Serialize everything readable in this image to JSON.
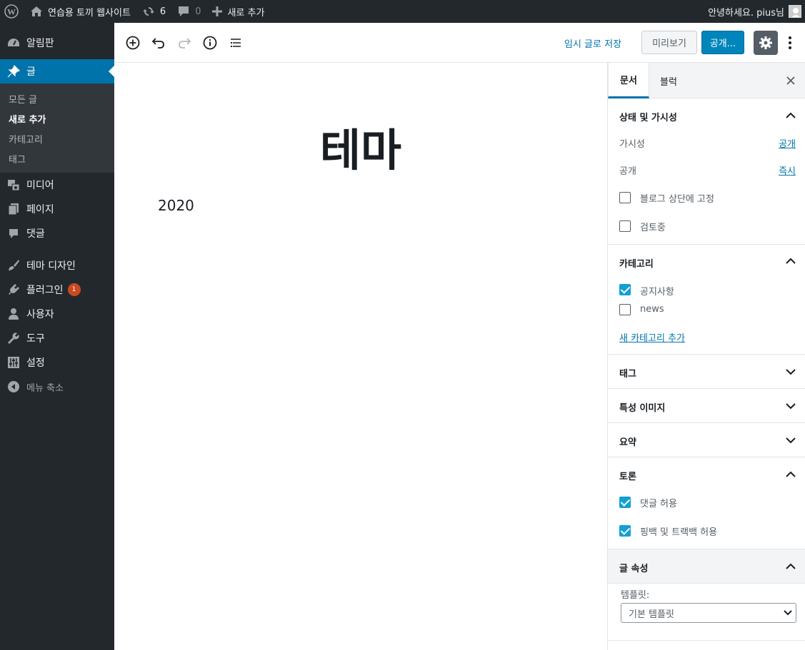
{
  "adminbar": {
    "site_name": "연습용 토끼 웹사이트",
    "updates_count": "6",
    "comments_count": "0",
    "new_label": "새로 추가",
    "greeting": "안녕하세요. pius님"
  },
  "menu": {
    "dashboard": "알림판",
    "posts": "글",
    "posts_sub": [
      "모든 글",
      "새로 추가",
      "카테고리",
      "태그"
    ],
    "media": "미디어",
    "pages": "페이지",
    "comments": "댓글",
    "appearance": "테마 디자인",
    "plugins": "플러그인",
    "plugins_badge": "1",
    "users": "사용자",
    "tools": "도구",
    "settings": "설정",
    "collapse": "메뉴 축소"
  },
  "toolbar": {
    "save_draft": "임시 글로 저장",
    "preview": "미리보기",
    "publish": "공개..."
  },
  "post": {
    "title": "테마",
    "body": "2020"
  },
  "sidebar": {
    "tabs": [
      "문서",
      "블럭"
    ],
    "status": {
      "heading": "상태 및 가시성",
      "visibility_label": "가시성",
      "visibility_value": "공개",
      "publish_label": "공개",
      "publish_value": "즉시",
      "sticky_label": "블로그 상단에 고정",
      "pending_label": "검토중"
    },
    "categories": {
      "heading": "카테고리",
      "items": [
        {
          "label": "공지사항",
          "checked": true
        },
        {
          "label": "news",
          "checked": false
        }
      ],
      "add_new": "새 카테고리 추가"
    },
    "tags_heading": "태그",
    "featured_heading": "특성 이미지",
    "excerpt_heading": "요약",
    "discussion": {
      "heading": "토론",
      "allow_comments": "댓글 허용",
      "allow_pings": "핑백 및 트랙백 허용"
    },
    "attributes": {
      "heading": "글 속성",
      "template_label": "템플릿:",
      "template_value": "기본 템플릿"
    }
  },
  "colors": {
    "adminbar_bg": "#23282d",
    "menu_current": "#0073aa",
    "publish_button": "#0085ba",
    "checkbox_checked": "#11a0d2",
    "badge": "#ca4a1f"
  }
}
